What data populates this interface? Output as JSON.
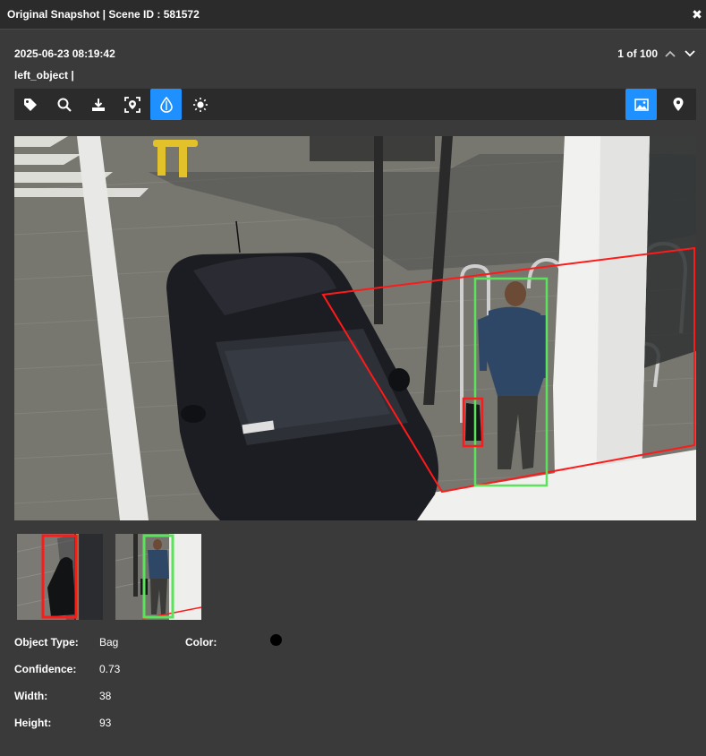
{
  "window": {
    "title": "Original Snapshot | Scene ID : 581572"
  },
  "header": {
    "timestamp": "2025-06-23 08:19:42",
    "subtitle": "left_object |",
    "pager": "1 of 100"
  },
  "toolbar": {
    "left_tools": [
      "tag-icon",
      "zoom-icon",
      "download-icon",
      "face-scan-icon",
      "color-drop-icon",
      "brightness-icon"
    ],
    "active_tool": "color-drop-icon",
    "right_tools": [
      "image-icon",
      "location-pin-icon"
    ],
    "active_right_tool": "image-icon"
  },
  "details": {
    "object_type_label": "Object Type:",
    "object_type": "Bag",
    "color_label": "Color:",
    "color_value": "#000000",
    "confidence_label": "Confidence:",
    "confidence": "0.73",
    "width_label": "Width:",
    "width": "38",
    "height_label": "Height:",
    "height": "93"
  },
  "colors": {
    "accent": "#1e90ff",
    "zone": "#ff1a1a",
    "person_box": "#5be35b",
    "bag_box": "#ff1a1a"
  }
}
